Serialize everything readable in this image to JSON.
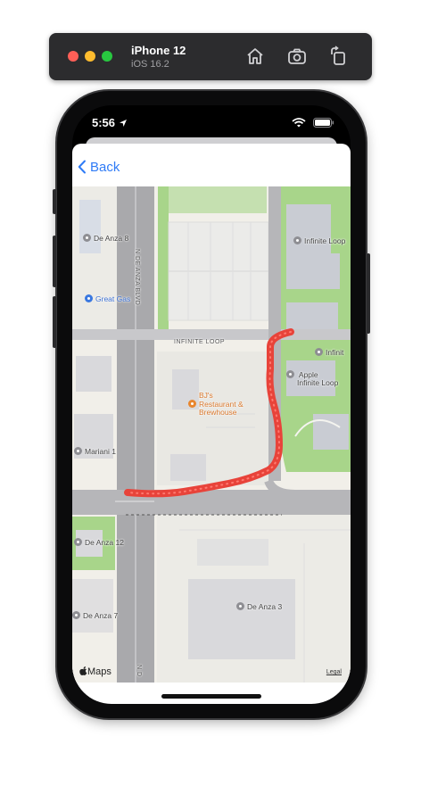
{
  "simulator": {
    "device_name": "iPhone 12",
    "os_version": "iOS 16.2"
  },
  "status_bar": {
    "time": "5:56"
  },
  "nav": {
    "back_label": "Back"
  },
  "map": {
    "labels": {
      "de_anza_8": "De Anza 8",
      "great_gas": "Great Gas",
      "n_de_anza_blvd": "N DE ANZA BLVD",
      "infinite_loop_road": "INFINITE LOOP",
      "infinite_loop_top": "Infinite Loop",
      "infinite_right": "Infinit",
      "apple_infinite_loop_1": "Apple",
      "apple_infinite_loop_2": "Infinite Loop",
      "bjs_1": "BJ's",
      "bjs_2": "Restaurant &",
      "bjs_3": "Brewhouse",
      "mariani_1": "Mariani 1",
      "de_anza_12": "De Anza 12",
      "de_anza_7": "De Anza 7",
      "de_anza_3": "De Anza 3",
      "n_d_bottom": "N D"
    },
    "attribution": {
      "maps_logo": "Maps",
      "legal": "Legal"
    },
    "colors": {
      "route": "#e8433a",
      "park": "#a8d58a",
      "road": "#a9a9ac",
      "building": "#d9d9dc"
    }
  }
}
